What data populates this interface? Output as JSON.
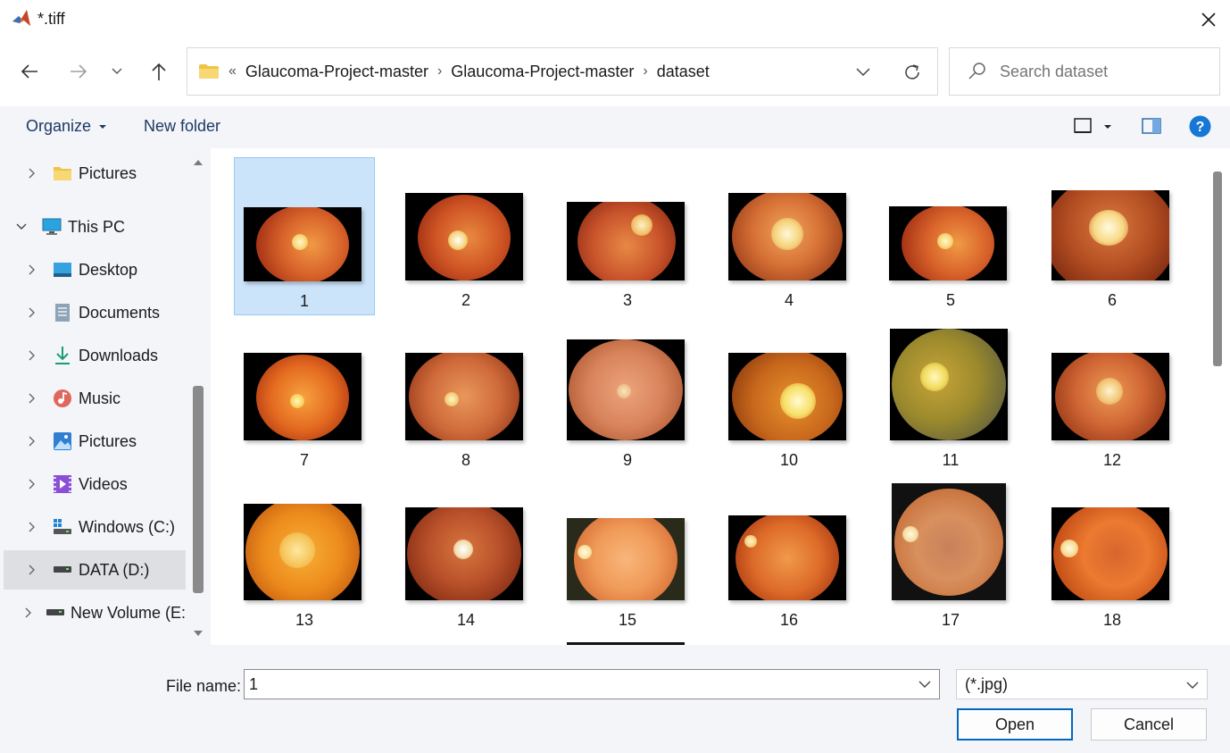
{
  "window": {
    "title": "*.tiff"
  },
  "address": {
    "overflow": "«",
    "crumbs": [
      "Glaucoma-Project-master",
      "Glaucoma-Project-master",
      "dataset"
    ],
    "search_placeholder": "Search dataset"
  },
  "commands": {
    "organize": "Organize",
    "new_folder": "New folder",
    "help": "?"
  },
  "nav": {
    "items": [
      {
        "label": "Pictures"
      },
      {
        "label": "This PC"
      },
      {
        "label": "Desktop"
      },
      {
        "label": "Documents"
      },
      {
        "label": "Downloads"
      },
      {
        "label": "Music"
      },
      {
        "label": "Pictures"
      },
      {
        "label": "Videos"
      },
      {
        "label": "Windows (C:)"
      },
      {
        "label": "DATA (D:)"
      },
      {
        "label": "New Volume (E:"
      }
    ],
    "selected": "DATA (D:)"
  },
  "files": {
    "items": [
      "1",
      "2",
      "3",
      "4",
      "5",
      "6",
      "7",
      "8",
      "9",
      "10",
      "11",
      "12",
      "13",
      "14",
      "15",
      "16",
      "17",
      "18"
    ],
    "selected": "1"
  },
  "footer": {
    "file_name_label": "File name:",
    "file_name_value": "1",
    "filter_value": "(*.jpg)",
    "open_label": "Open",
    "cancel_label": "Cancel"
  },
  "colors": {
    "accent": "#0067c0",
    "selection": "#cce4fa",
    "pane_bg": "#f3f5f9"
  }
}
